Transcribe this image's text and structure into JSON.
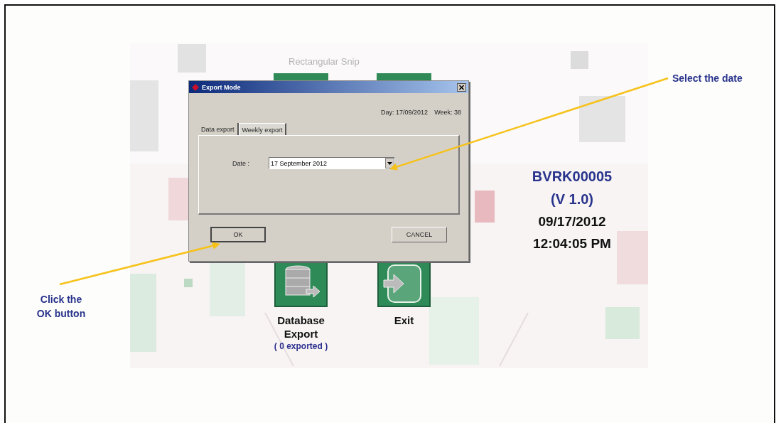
{
  "screen": {
    "ghost_label": "Rectangular Snip",
    "tiles": [
      {
        "kind": "database",
        "label": "Database Export",
        "sublabel": "( 0 exported )"
      },
      {
        "kind": "exit",
        "label": "Exit"
      }
    ],
    "info": {
      "device_id": "BVRK00005",
      "version": "(V 1.0)",
      "date": "09/17/2012",
      "time": "12:04:05 PM"
    }
  },
  "dialog": {
    "title": "Export Mode",
    "day": "Day: 17/09/2012",
    "week": "Week: 38",
    "tabs": [
      {
        "label": "Data export",
        "selected": true
      },
      {
        "label": "Weekly export",
        "selected": false
      }
    ],
    "date_label": "Date :",
    "date_value": "17 September 2012",
    "buttons": [
      {
        "kind": "ok",
        "label": "OK"
      },
      {
        "kind": "cancel",
        "label": "CANCEL"
      }
    ]
  },
  "annotations": [
    {
      "kind": "date",
      "text": "Select the date"
    },
    {
      "kind": "ok",
      "text": "Click the OK button"
    }
  ]
}
